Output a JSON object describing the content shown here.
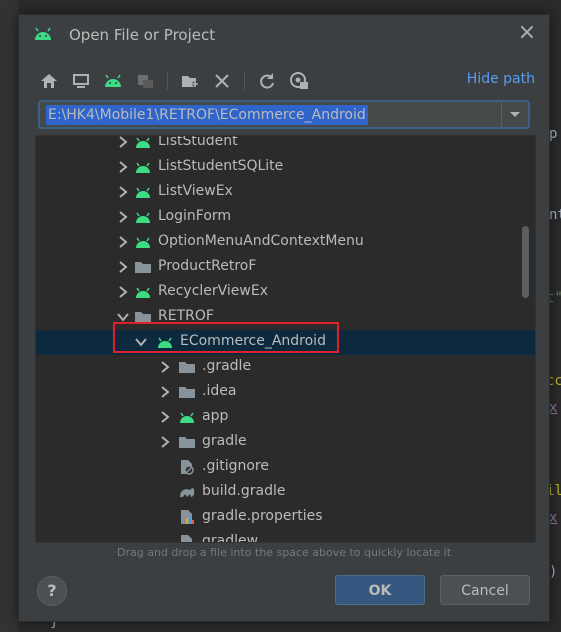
{
  "dialog": {
    "title": "Open File or Project",
    "hide_path_label": "Hide path",
    "path_value": "E:\\HK4\\Mobile1\\RETROF\\ECommerce_Android",
    "hint": "Drag and drop a file into the space above to quickly locate it",
    "ok_label": "OK",
    "cancel_label": "Cancel",
    "help_label": "?"
  },
  "toolbar": {
    "icons": [
      "home-icon",
      "desktop-icon",
      "project-icon",
      "module-icon",
      "new-folder-icon",
      "delete-icon",
      "refresh-icon",
      "show-hidden-icon"
    ]
  },
  "tree": {
    "items": [
      {
        "label": "ListStudent",
        "icon": "android-folder"
      },
      {
        "label": "ListStudentSQLite",
        "icon": "android-folder"
      },
      {
        "label": "ListViewEx",
        "icon": "android-folder"
      },
      {
        "label": "LoginForm",
        "icon": "android-folder"
      },
      {
        "label": "OptionMenuAndContextMenu",
        "icon": "android-folder"
      },
      {
        "label": "ProductRetroF",
        "icon": "folder"
      },
      {
        "label": "RecyclerViewEx",
        "icon": "android-folder"
      },
      {
        "label": "RETROF",
        "icon": "folder"
      },
      {
        "label": "ECommerce_Android",
        "icon": "android-folder"
      },
      {
        "label": ".gradle",
        "icon": "folder"
      },
      {
        "label": ".idea",
        "icon": "folder"
      },
      {
        "label": "app",
        "icon": "android-folder"
      },
      {
        "label": "gradle",
        "icon": "folder"
      },
      {
        "label": ".gitignore",
        "icon": "gitignore-file"
      },
      {
        "label": "build.gradle",
        "icon": "gradle-file"
      },
      {
        "label": "gradle.properties",
        "icon": "properties-file"
      },
      {
        "label": "gradlew",
        "icon": "file"
      }
    ]
  },
  "background_code": {
    "fragments": [
      "p",
      "nt",
      "t\"",
      "cc",
      "x",
      "il",
      "x",
      ")",
      "}"
    ]
  },
  "colors": {
    "accent": "#589df6",
    "android_green": "#3ddc84",
    "selection": "#0d293e",
    "highlight_box": "#e31f2b"
  }
}
